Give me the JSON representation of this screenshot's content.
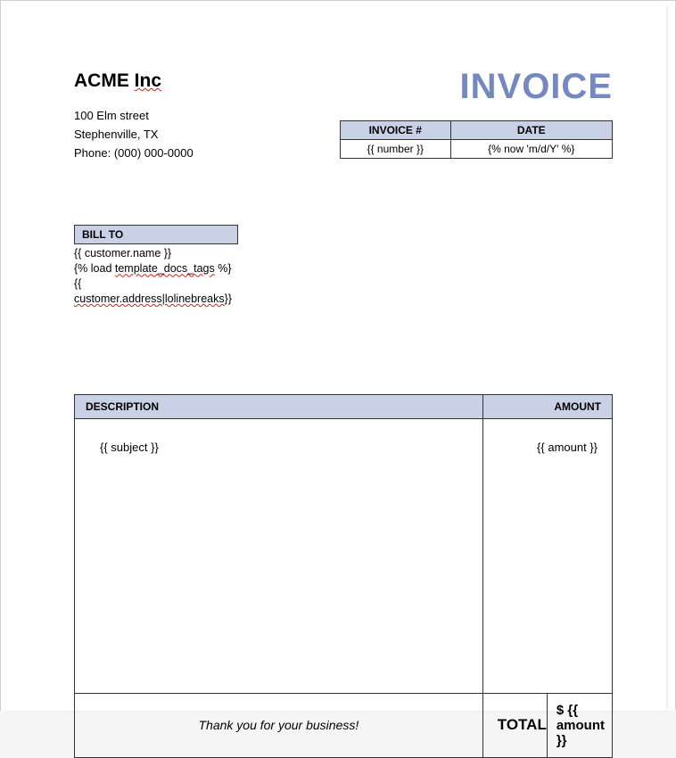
{
  "company": {
    "name_part1": "ACME ",
    "name_part2": "Inc",
    "address_line1": "100 Elm street",
    "address_line2": "Stephenville, TX",
    "phone_line": "Phone: (000) 000-0000"
  },
  "title": "INVOICE",
  "meta": {
    "invoice_no_label": "INVOICE #",
    "date_label": "DATE",
    "invoice_no_value": "{{ number }}",
    "date_value": "{% now 'm/d/Y' %}"
  },
  "billto": {
    "header": "BILL TO",
    "line1": "{{ customer.name }}",
    "line2a": "{% load ",
    "line2b": "template_docs_tags",
    "line2c": " %}{{ ",
    "line3a": "customer.address|lolinebreaks",
    "line3b": "}}"
  },
  "items_table": {
    "col_description": "DESCRIPTION",
    "col_amount": "AMOUNT",
    "row_description": "{{ subject }}",
    "row_amount": "{{ amount }}"
  },
  "footer": {
    "thanks": "Thank you for your business!",
    "total_label": "TOTAL",
    "total_value": "$ {{ amount }}"
  }
}
